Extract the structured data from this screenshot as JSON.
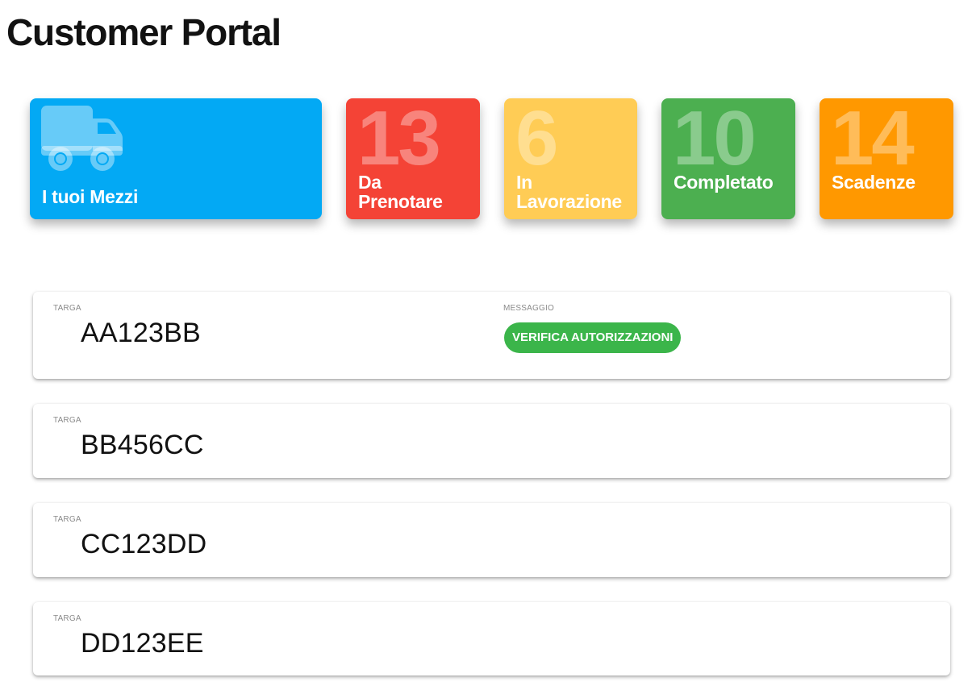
{
  "header": {
    "title": "Customer Portal"
  },
  "tiles": [
    {
      "label": "I tuoi Mezzi",
      "icon": "truck-icon",
      "color": "#03a9f4"
    },
    {
      "count": "13",
      "label_line1": "Da",
      "label_line2": "Prenotare",
      "color": "#f44336"
    },
    {
      "count": "6",
      "label_line1": "In",
      "label_line2": "Lavorazione",
      "color": "#ffcc55"
    },
    {
      "count": "10",
      "label": "Completato",
      "color": "#4caf50"
    },
    {
      "count": "14",
      "label": "Scadenze",
      "color": "#ff9800"
    }
  ],
  "vehicles": [
    {
      "label": "TARGA",
      "plate": "AA123BB",
      "message_label": "MESSAGGIO",
      "message": "VERIFICA AUTORIZZAZIONI",
      "message_color": "#3bb54a"
    },
    {
      "label": "TARGA",
      "plate": "BB456CC"
    },
    {
      "label": "TARGA",
      "plate": "CC123DD"
    },
    {
      "label": "TARGA",
      "plate": "DD123EE"
    }
  ]
}
